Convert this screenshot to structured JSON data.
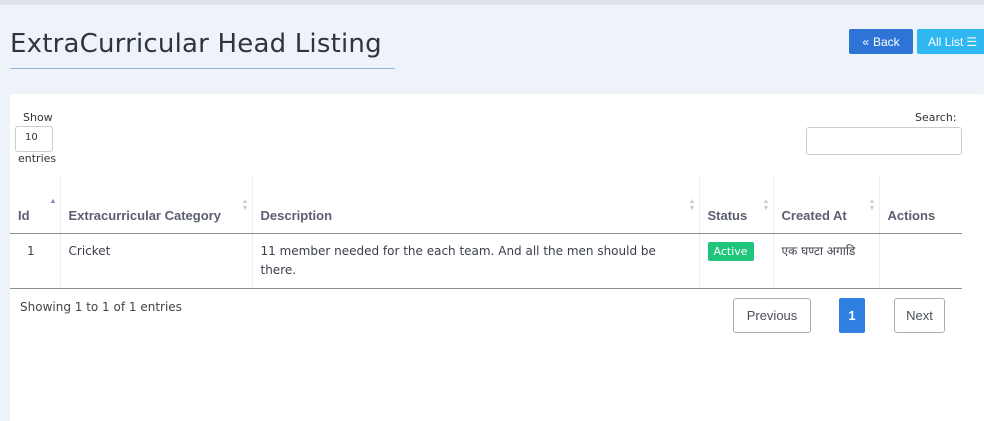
{
  "page": {
    "title": "ExtraCurricular Head Listing"
  },
  "toolbar": {
    "back_label": "Back",
    "back_icon": "double-chevron-left-icon",
    "all_list_label": "All List",
    "all_list_icon": "list-icon"
  },
  "table_controls": {
    "show_label": "Show",
    "show_value": "10",
    "entries_label": "entries",
    "search_label": "Search:",
    "search_value": ""
  },
  "table": {
    "columns": [
      "Id",
      "Extracurricular Category",
      "Description",
      "Status",
      "Created At",
      "Actions"
    ],
    "rows": [
      {
        "id": "1",
        "category": "Cricket",
        "description": "11 member needed for the each team. And all the men should be there.",
        "status": "Active",
        "created_at": "एक घण्टा अगाडि",
        "actions": ""
      }
    ]
  },
  "pagination": {
    "info": "Showing 1 to 1 of 1 entries",
    "previous_label": "Previous",
    "current_page": "1",
    "next_label": "Next"
  },
  "colors": {
    "back_button": "#2d74d6",
    "all_list_button": "#2eb7f0",
    "active_badge": "#1fc57a",
    "current_page": "#2f80e0"
  }
}
